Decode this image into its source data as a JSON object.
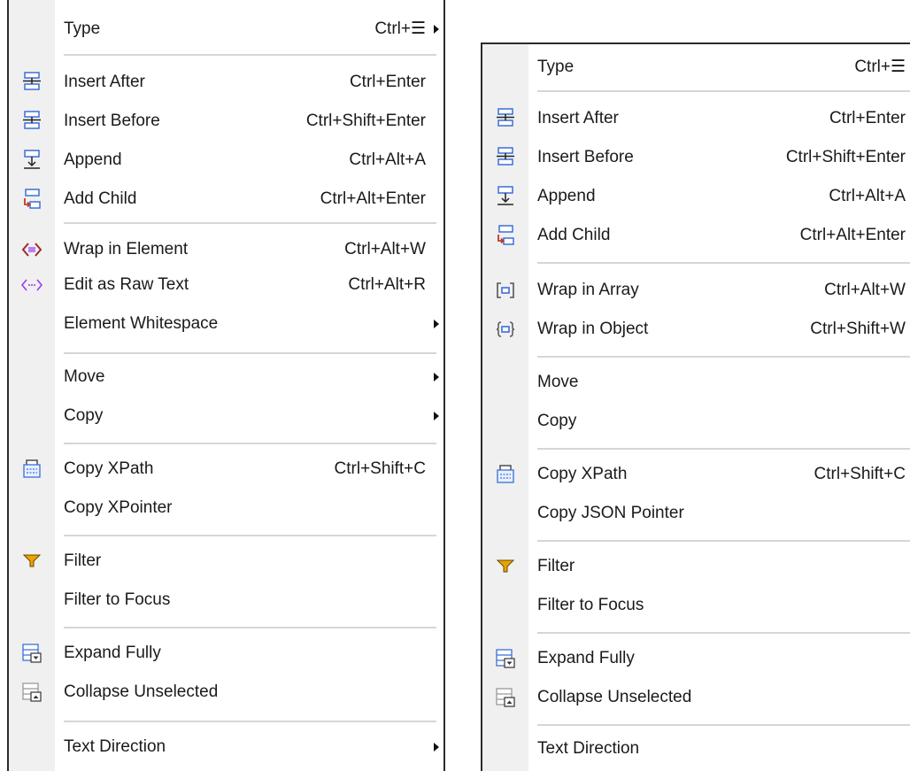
{
  "left_menu": {
    "items": [
      {
        "label": "Type",
        "shortcut": "Ctrl+☰",
        "submenu": true,
        "icon": ""
      },
      {
        "label": "Insert After",
        "shortcut": "Ctrl+Enter",
        "icon": "insert-after-icon"
      },
      {
        "label": "Insert Before",
        "shortcut": "Ctrl+Shift+Enter",
        "icon": "insert-before-icon"
      },
      {
        "label": "Append",
        "shortcut": "Ctrl+Alt+A",
        "icon": "append-icon"
      },
      {
        "label": "Add Child",
        "shortcut": "Ctrl+Alt+Enter",
        "icon": "add-child-icon"
      },
      {
        "label": "Wrap in Element",
        "shortcut": "Ctrl+Alt+W",
        "icon": "wrap-element-icon"
      },
      {
        "label": "Edit as Raw Text",
        "shortcut": "Ctrl+Alt+R",
        "icon": "raw-text-icon"
      },
      {
        "label": "Element Whitespace",
        "shortcut": "",
        "submenu": true,
        "icon": ""
      },
      {
        "label": "Move",
        "shortcut": "",
        "submenu": true,
        "icon": ""
      },
      {
        "label": "Copy",
        "shortcut": "",
        "submenu": true,
        "icon": ""
      },
      {
        "label": "Copy XPath",
        "shortcut": "Ctrl+Shift+C",
        "icon": "copy-path-icon"
      },
      {
        "label": "Copy XPointer",
        "shortcut": "",
        "icon": ""
      },
      {
        "label": "Filter",
        "shortcut": "",
        "icon": "filter-icon"
      },
      {
        "label": "Filter to Focus",
        "shortcut": "",
        "icon": ""
      },
      {
        "label": "Expand Fully",
        "shortcut": "",
        "icon": "expand-fully-icon"
      },
      {
        "label": "Collapse Unselected",
        "shortcut": "",
        "icon": "collapse-unselected-icon"
      },
      {
        "label": "Text Direction",
        "shortcut": "",
        "submenu": true,
        "icon": ""
      }
    ]
  },
  "right_menu": {
    "items": [
      {
        "label": "Type",
        "shortcut": "Ctrl+☰",
        "submenu": true,
        "icon": ""
      },
      {
        "label": "Insert After",
        "shortcut": "Ctrl+Enter",
        "icon": "insert-after-icon"
      },
      {
        "label": "Insert Before",
        "shortcut": "Ctrl+Shift+Enter",
        "icon": "insert-before-icon"
      },
      {
        "label": "Append",
        "shortcut": "Ctrl+Alt+A",
        "icon": "append-icon"
      },
      {
        "label": "Add Child",
        "shortcut": "Ctrl+Alt+Enter",
        "icon": "add-child-icon"
      },
      {
        "label": "Wrap in Array",
        "shortcut": "Ctrl+Alt+W",
        "icon": "wrap-array-icon"
      },
      {
        "label": "Wrap in Object",
        "shortcut": "Ctrl+Shift+W",
        "icon": "wrap-object-icon"
      },
      {
        "label": "Move",
        "shortcut": "",
        "submenu": true,
        "icon": ""
      },
      {
        "label": "Copy",
        "shortcut": "",
        "submenu": true,
        "icon": ""
      },
      {
        "label": "Copy XPath",
        "shortcut": "Ctrl+Shift+C",
        "icon": "copy-path-icon"
      },
      {
        "label": "Copy JSON Pointer",
        "shortcut": "",
        "icon": ""
      },
      {
        "label": "Filter",
        "shortcut": "",
        "icon": "filter-icon"
      },
      {
        "label": "Filter to Focus",
        "shortcut": "",
        "icon": ""
      },
      {
        "label": "Expand Fully",
        "shortcut": "",
        "icon": "expand-fully-icon"
      },
      {
        "label": "Collapse Unselected",
        "shortcut": "",
        "icon": "collapse-unselected-icon"
      },
      {
        "label": "Text Direction",
        "shortcut": "",
        "submenu": true,
        "icon": ""
      }
    ]
  },
  "colors": {
    "icon_blue": "#3a6fd8",
    "icon_red": "#c0392b",
    "wrap_purple": "#9b30ff",
    "filter_orange": "#e8a400",
    "gutter": "#f0f0f0",
    "separator": "#d6d6d6"
  }
}
